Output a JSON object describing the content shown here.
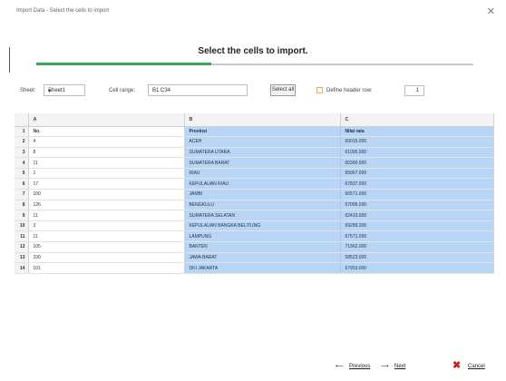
{
  "window": {
    "title": "Import Data - Select the cells to import"
  },
  "heading": "Select the cells to import.",
  "progress": {
    "fraction": 0.4,
    "color": "#3aa55a"
  },
  "toolbar": {
    "sheet_label": "Sheet:",
    "sheet_value": "Sheet1",
    "cell_range_label": "Cell range:",
    "cell_range_value": "B1:C34",
    "select_all_label": "Select all",
    "define_header_label": "Define header row:",
    "header_row_value": "1"
  },
  "columns": [
    "A",
    "B",
    "C"
  ],
  "rows": [
    [
      "1",
      "No.",
      "Provinsi",
      "Nilai rata"
    ],
    [
      "2",
      "4",
      "ACEH",
      "60015.000"
    ],
    [
      "3",
      "8",
      "SUMATERA UTARA",
      "61095.000"
    ],
    [
      "4",
      "11",
      "SUMATERA BARAT",
      "60390.000"
    ],
    [
      "5",
      "1",
      "RIAU",
      "65967.000"
    ],
    [
      "6",
      "17",
      "KEPULAUAN RIAU",
      "67837.000"
    ],
    [
      "7",
      "100",
      "JAMBI",
      "66571.000"
    ],
    [
      "8",
      "126",
      "BENGKULU",
      "57095.000"
    ],
    [
      "9",
      "11",
      "SUMATERA SELATAN",
      "62410.000"
    ],
    [
      "10",
      "3",
      "KEPULAUAN BANGKA BELITUNG",
      "69289.000"
    ],
    [
      "11",
      "11",
      "LAMPUNG",
      "67571.000"
    ],
    [
      "12",
      "105",
      "BANTEN",
      "71962.000"
    ],
    [
      "13",
      "100",
      "JAWA BARAT",
      "58523.000"
    ],
    [
      "14",
      "101",
      "DKI JAKARTA",
      "67953.000"
    ]
  ],
  "buttons": {
    "previous": "Previous",
    "next": "Next",
    "cancel": "Cancel"
  },
  "colors": {
    "selection": "#b9d5f6",
    "cancel_icon": "#c6251b"
  }
}
